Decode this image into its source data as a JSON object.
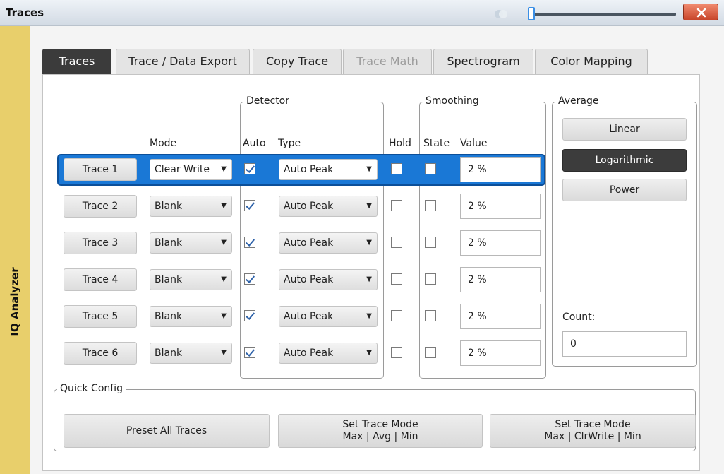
{
  "window": {
    "title": "Traces",
    "close_label": "X",
    "slider_value_fraction": 0.03
  },
  "side_label": "IQ Analyzer",
  "tabs": [
    {
      "label": "Traces",
      "state": "active"
    },
    {
      "label": "Trace / Data Export",
      "state": "normal"
    },
    {
      "label": "Copy Trace",
      "state": "normal"
    },
    {
      "label": "Trace Math",
      "state": "disabled"
    },
    {
      "label": "Spectrogram",
      "state": "normal"
    },
    {
      "label": "Color Mapping",
      "state": "normal"
    }
  ],
  "headers": {
    "detector_group": "Detector",
    "smoothing_group": "Smoothing",
    "mode": "Mode",
    "auto": "Auto",
    "type": "Type",
    "hold": "Hold",
    "state": "State",
    "value": "Value"
  },
  "traces": [
    {
      "name": "Trace 1",
      "mode": "Clear Write",
      "auto": true,
      "type": "Auto Peak",
      "hold": false,
      "smoothing_state": false,
      "smoothing_value": "2 %",
      "selected": true
    },
    {
      "name": "Trace 2",
      "mode": "Blank",
      "auto": true,
      "type": "Auto Peak",
      "hold": false,
      "smoothing_state": false,
      "smoothing_value": "2 %",
      "selected": false
    },
    {
      "name": "Trace 3",
      "mode": "Blank",
      "auto": true,
      "type": "Auto Peak",
      "hold": false,
      "smoothing_state": false,
      "smoothing_value": "2 %",
      "selected": false
    },
    {
      "name": "Trace 4",
      "mode": "Blank",
      "auto": true,
      "type": "Auto Peak",
      "hold": false,
      "smoothing_state": false,
      "smoothing_value": "2 %",
      "selected": false
    },
    {
      "name": "Trace 5",
      "mode": "Blank",
      "auto": true,
      "type": "Auto Peak",
      "hold": false,
      "smoothing_state": false,
      "smoothing_value": "2 %",
      "selected": false
    },
    {
      "name": "Trace 6",
      "mode": "Blank",
      "auto": true,
      "type": "Auto Peak",
      "hold": false,
      "smoothing_state": false,
      "smoothing_value": "2 %",
      "selected": false
    }
  ],
  "average": {
    "group_label": "Average",
    "options": [
      "Linear",
      "Logarithmic",
      "Power"
    ],
    "selected": "Logarithmic",
    "count_label": "Count:",
    "count_value": "0"
  },
  "quick_config": {
    "group_label": "Quick Config",
    "buttons": [
      {
        "line1": "Preset All Traces",
        "line2": ""
      },
      {
        "line1": "Set Trace Mode",
        "line2": "Max | Avg | Min"
      },
      {
        "line1": "Set Trace Mode",
        "line2": "Max | ClrWrite | Min"
      }
    ]
  },
  "colors": {
    "accent_blue": "#1a78d6",
    "side_strip": "#e8cf6b",
    "close_button": "#d9583a",
    "active_tab": "#3b3b3b"
  }
}
